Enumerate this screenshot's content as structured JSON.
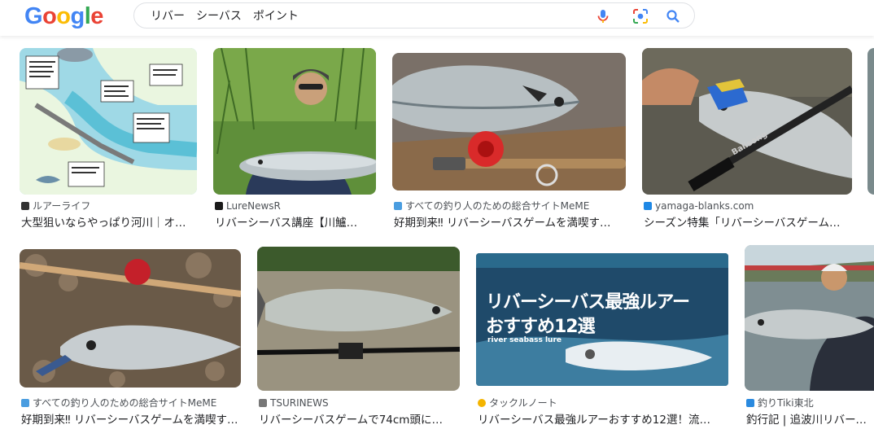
{
  "search": {
    "query": "リバー　シーバス　ポイント"
  },
  "logo": {
    "letters": [
      "G",
      "o",
      "o",
      "g",
      "l",
      "e"
    ]
  },
  "results": [
    {
      "source": "ルアーライフ",
      "title": "大型狙いならやっぱり河川｜オ…"
    },
    {
      "source": "LureNewsR",
      "title": "リバーシーバス講座【川鱸…"
    },
    {
      "source": "すべての釣り人のための総合サイトMeME",
      "title": "好期到来‼ リバーシーバスゲームを満喫す…"
    },
    {
      "source": "yamaga-blanks.com",
      "title": "シーズン特集「リバーシーバスゲーム…"
    },
    {
      "source": "すべての釣り人のための総合サイトMeME",
      "title": "好期到来‼ リバーシーバスゲームを満喫す…"
    },
    {
      "source": "TSURINEWS",
      "title": "リバーシーバスゲームで74cm頭に…"
    },
    {
      "source": "タックルノート",
      "title": "リバーシーバス最強ルアーおすすめ12選！流…"
    },
    {
      "source": "釣りTiki東北",
      "title": "釣行記 | 追波川リバーシ…"
    }
  ],
  "image_text": {
    "lure_banner_line1": "リバーシーバス最強ルアー",
    "lure_banner_line2": "おすすめ12選",
    "lure_banner_sub": "river seabass lure",
    "rod_brand": "Balisong"
  },
  "colors": {
    "google_blue": "#4285F4",
    "google_red": "#EA4335",
    "google_yellow": "#FBBC05",
    "google_green": "#34A853"
  }
}
